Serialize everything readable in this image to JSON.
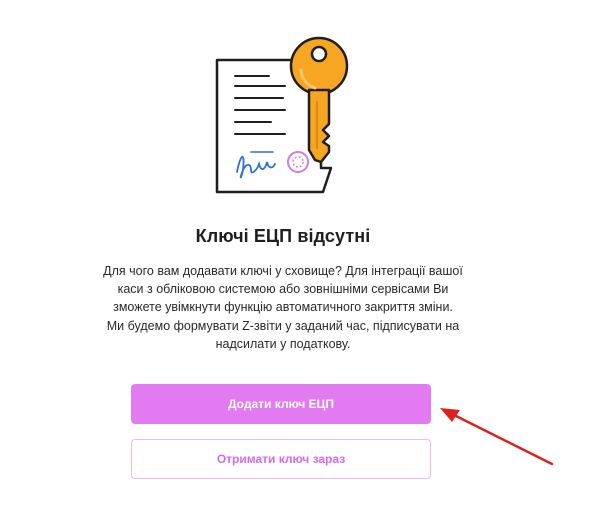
{
  "empty_state": {
    "title": "Ключі ЕЦП відсутні",
    "description_lines": [
      "Для чого вам додавати ключі у сховище? Для інтеграції вашої",
      "каси з обліковою системою або зовнішніми сервісами Ви",
      "зможете увімкнути функцію автоматичного закриття зміни.",
      "Ми будемо формувати Z-звіти у заданий час, підписувати на",
      "надсилати у податкову."
    ],
    "illustration_icon": "document-with-key-icon"
  },
  "buttons": {
    "add_key_label": "Додати ключ ЕЦП",
    "get_key_label": "Отримати ключ зараз"
  },
  "annotation": {
    "arrow_icon": "red-arrow-icon"
  },
  "colors": {
    "primary": "#e27bf1",
    "secondary_text": "#d56ae6",
    "secondary_border": "#ecb9f3",
    "key": "#f6a623",
    "arrow": "#e0201f"
  }
}
